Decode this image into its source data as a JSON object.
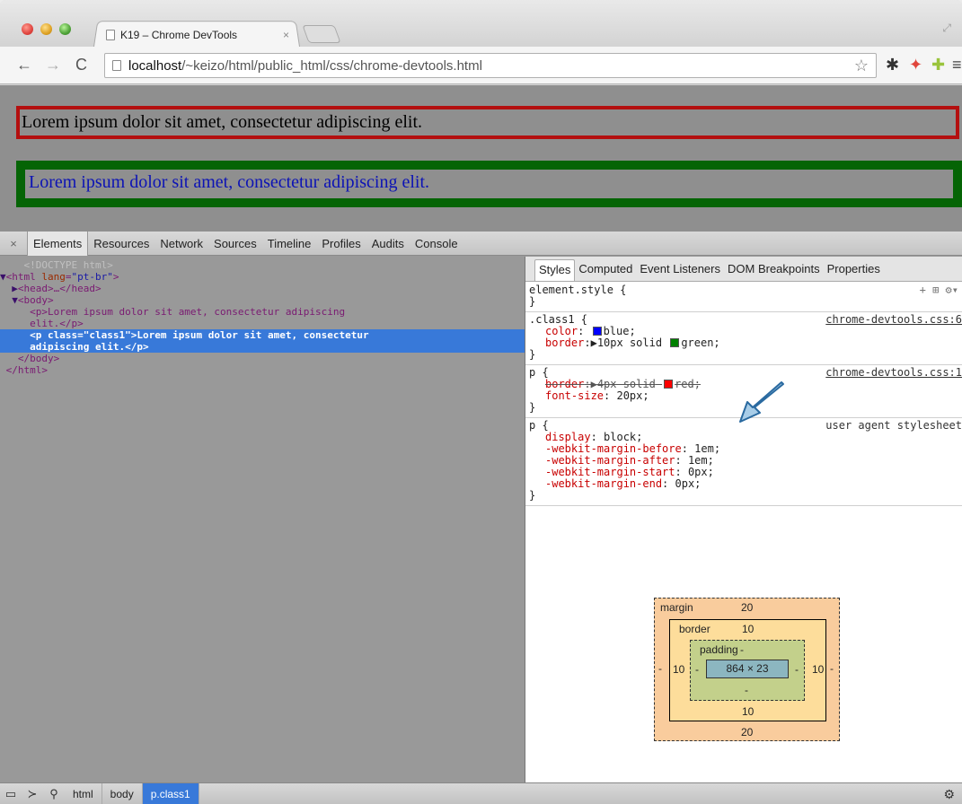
{
  "browser": {
    "tab_title": "K19 – Chrome DevTools",
    "tab_close": "×",
    "url_host": "localhost",
    "url_path": "/~keizo/html/public_html/css/chrome-devtools.html"
  },
  "page": {
    "paragraph1": "Lorem ipsum dolor sit amet, consectetur adipiscing elit.",
    "paragraph2": "Lorem ipsum dolor sit amet, consectetur adipiscing elit."
  },
  "devtools": {
    "close": "×",
    "tabs": [
      "Elements",
      "Resources",
      "Network",
      "Sources",
      "Timeline",
      "Profiles",
      "Audits",
      "Console"
    ],
    "dom": {
      "doctype": "<!DOCTYPE html>",
      "html_open_tag": "html",
      "html_attr": "lang",
      "html_attr_val": "\"pt-br\"",
      "head": "<head>…</head>",
      "body_open": "<body>",
      "p_line1": "<p>Lorem ipsum dolor sit amet, consectetur adipiscing",
      "p_line2": "elit.</p>",
      "sel_line1": "<p class=\"class1\">Lorem ipsum dolor sit amet, consectetur",
      "sel_line2": "adipiscing elit.</p>",
      "body_close": "</body>",
      "html_close": "</html>"
    },
    "sidebar_tabs": [
      "Styles",
      "Computed",
      "Event Listeners",
      "DOM Breakpoints",
      "Properties"
    ],
    "styles": {
      "element_style": "element.style {",
      "close_brace": "}",
      "rule1_selector": ".class1 {",
      "rule1_source": "chrome-devtools.css:6",
      "rule1_color_prop": "color",
      "rule1_color_val": "blue;",
      "rule1_border_prop": "border",
      "rule1_border_val1": "10px solid",
      "rule1_border_val2": "green;",
      "rule2_selector": "p {",
      "rule2_source": "chrome-devtools.css:1",
      "rule2_border_prop": "border",
      "rule2_border_val1": "4px solid",
      "rule2_border_val2": "red;",
      "rule2_font_prop": "font-size",
      "rule2_font_val": "20px;",
      "rule3_selector": "p {",
      "rule3_source": "user agent stylesheet",
      "ua_props": [
        {
          "prop": "display",
          "val": "block;"
        },
        {
          "prop": "-webkit-margin-before",
          "val": "1em;"
        },
        {
          "prop": "-webkit-margin-after",
          "val": "1em;"
        },
        {
          "prop": "-webkit-margin-start",
          "val": "0px;"
        },
        {
          "prop": "-webkit-margin-end",
          "val": "0px;"
        }
      ]
    },
    "box_model": {
      "margin_label": "margin",
      "margin_top": "20",
      "margin_bottom": "20",
      "margin_left": "-",
      "margin_right": "-",
      "border_label": "border",
      "border_top": "10",
      "border_bottom": "10",
      "border_left": "10",
      "border_right": "10",
      "padding_label": "padding",
      "padding_top": "-",
      "padding_bottom": "-",
      "padding_left": "-",
      "padding_right": "-",
      "content_size": "864 × 23"
    },
    "breadcrumbs": [
      "html",
      "body",
      "p.class1"
    ]
  },
  "colors": {
    "swatch_blue": "#0000ff",
    "swatch_green": "#008000",
    "swatch_red": "#ff0000",
    "selection": "#3879d9"
  }
}
